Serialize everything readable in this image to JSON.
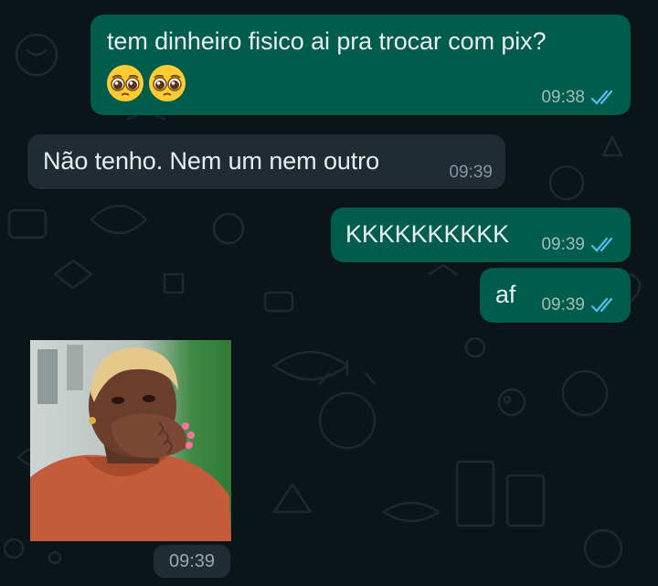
{
  "messages": [
    {
      "id": "m1",
      "direction": "outgoing",
      "text": "tem dinheiro fisico ai pra trocar com pix?",
      "emojis": [
        "pleading-face",
        "pleading-face"
      ],
      "time": "09:38",
      "status": "read"
    },
    {
      "id": "m2",
      "direction": "incoming",
      "text": "Não tenho. Nem um nem outro",
      "time": "09:39"
    },
    {
      "id": "m3",
      "direction": "outgoing",
      "text": "KKKKKKKKKK",
      "time": "09:39",
      "status": "read"
    },
    {
      "id": "m4",
      "direction": "outgoing",
      "text": "af",
      "time": "09:39",
      "status": "read"
    },
    {
      "id": "m5",
      "direction": "incoming",
      "type": "sticker",
      "sticker": "woman-covering-mouth-shocked",
      "time": "09:39"
    }
  ],
  "colors": {
    "background": "#0b1418",
    "outgoing_bubble": "#005c4b",
    "incoming_bubble": "#1f2c34",
    "read_ticks": "#53bdeb"
  }
}
